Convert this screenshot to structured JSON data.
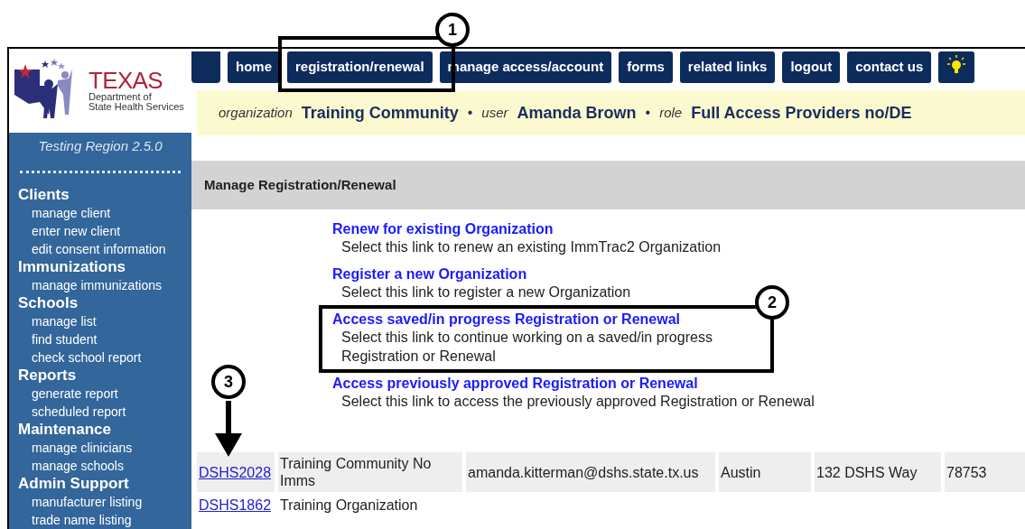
{
  "logo": {
    "title": "TEXAS",
    "subtitle_1": "Department of",
    "subtitle_2": "State Health Services"
  },
  "sidebar": {
    "region": "Testing Region 2.5.0",
    "sections": [
      {
        "title": "Clients",
        "items": [
          "manage client",
          "enter new client",
          "edit consent information"
        ]
      },
      {
        "title": "Immunizations",
        "items": [
          "manage immunizations"
        ]
      },
      {
        "title": "Schools",
        "items": [
          "manage list",
          "find student",
          "check school report"
        ]
      },
      {
        "title": "Reports",
        "items": [
          "generate report",
          "scheduled report"
        ]
      },
      {
        "title": "Maintenance",
        "items": [
          "manage clinicians",
          "manage schools"
        ]
      },
      {
        "title": "Admin Support",
        "items": [
          "manufacturer listing",
          "trade name listing"
        ]
      }
    ]
  },
  "nav": {
    "tabs": [
      "home",
      "registration/renewal",
      "manage access/account",
      "forms",
      "related links",
      "logout",
      "contact us"
    ]
  },
  "session": {
    "separator": "•",
    "fields": [
      {
        "label": "organization",
        "value": "Training Community"
      },
      {
        "label": "user",
        "value": "Amanda Brown"
      },
      {
        "label": "role",
        "value": "Full Access Providers no/DE"
      }
    ]
  },
  "panel": {
    "title": "Manage Registration/Renewal"
  },
  "options": [
    {
      "link": "Renew for existing Organization",
      "description": [
        "Select this link to renew an existing ImmTrac2 Organization"
      ]
    },
    {
      "link": "Register a new Organization",
      "description": [
        "Select this link to register a new Organization"
      ]
    },
    {
      "link": "Access saved/in progress Registration or Renewal",
      "description": [
        "Select this link to continue working on a saved/in progress",
        "Registration or Renewal"
      ]
    },
    {
      "link": "Access previously approved Registration or Renewal",
      "description": [
        "Select this link to access the previously approved Registration or Renewal"
      ]
    }
  ],
  "table": {
    "rows": [
      {
        "cells": [
          "DSHS2028",
          "Training Community No Imms",
          "amanda.kitterman@dshs.state.tx.us",
          "Austin",
          "132 DSHS Way",
          "78753"
        ]
      },
      {
        "cells": [
          "DSHS1862",
          "Training Organization"
        ]
      }
    ]
  },
  "callouts": [
    {
      "label": "1"
    },
    {
      "label": "2"
    },
    {
      "label": "3"
    }
  ]
}
